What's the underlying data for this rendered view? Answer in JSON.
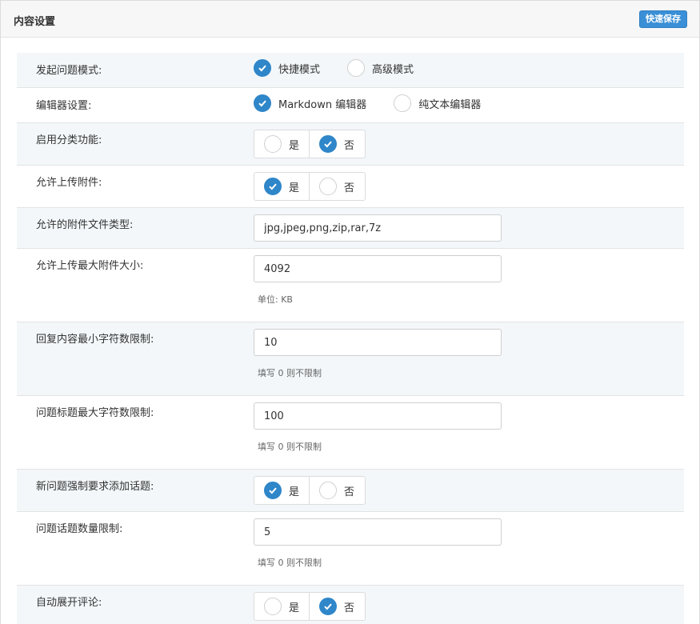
{
  "header": {
    "title": "内容设置",
    "save_label": "快速保存"
  },
  "rows": {
    "question_mode": {
      "label": "发起问题模式:",
      "options": [
        "快捷模式",
        "高级模式"
      ],
      "selected": 0
    },
    "editor": {
      "label": "编辑器设置:",
      "options": [
        "Markdown 编辑器",
        "纯文本编辑器"
      ],
      "selected": 0
    },
    "category": {
      "label": "启用分类功能:",
      "options": [
        "是",
        "否"
      ],
      "selected": 1
    },
    "upload": {
      "label": "允许上传附件:",
      "options": [
        "是",
        "否"
      ],
      "selected": 0
    },
    "file_types": {
      "label": "允许的附件文件类型:",
      "value": "jpg,jpeg,png,zip,rar,7z"
    },
    "max_size": {
      "label": "允许上传最大附件大小:",
      "value": "4092",
      "help": "单位: KB"
    },
    "reply_min": {
      "label": "回复内容最小字符数限制:",
      "value": "10",
      "help": "填写 0 则不限制"
    },
    "title_max": {
      "label": "问题标题最大字符数限制:",
      "value": "100",
      "help": "填写 0 则不限制"
    },
    "force_topic": {
      "label": "新问题强制要求添加话题:",
      "options": [
        "是",
        "否"
      ],
      "selected": 0
    },
    "topic_limit": {
      "label": "问题话题数量限制:",
      "value": "5",
      "help": "填写 0 则不限制"
    },
    "auto_expand": {
      "label": "自动展开评论:",
      "options": [
        "是",
        "否"
      ],
      "selected": 1
    }
  },
  "colors": {
    "accent": "#2f86c9",
    "shaded_row": "#f3f7fa",
    "button": "#3a8fd6"
  }
}
